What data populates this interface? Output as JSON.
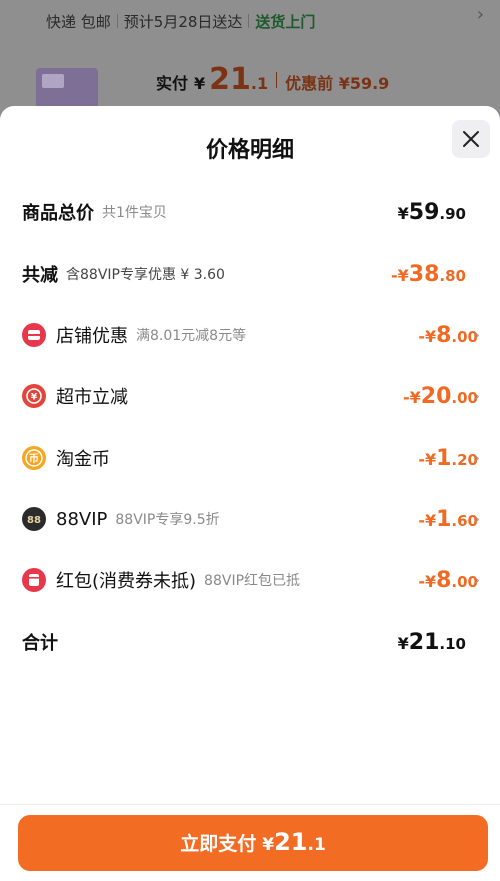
{
  "background": {
    "shipping": {
      "method": "快递 包邮",
      "eta": "预计5月28日送达",
      "delivery": "送货上门"
    },
    "payment": {
      "label": "实付",
      "currency": "¥",
      "int": "21",
      "dec": ".1",
      "before_discount": "优惠前 ¥59.9"
    }
  },
  "sheet": {
    "title": "价格明细",
    "rows": [
      {
        "label": "商品总价",
        "sub": "共1件宝贝",
        "sign": "",
        "currency": "¥",
        "int": "59",
        "dec": ".90",
        "color": "#111111"
      },
      {
        "label": "共减",
        "sub": "含88VIP专享优惠 ¥ 3.60",
        "sign": "-",
        "currency": "¥",
        "int": "38",
        "dec": ".80",
        "color": "#f06a23"
      },
      {
        "label": "店铺优惠",
        "sub": "满8.01元减8元等",
        "icon": "shop-coupon-icon",
        "sign": "-",
        "currency": "¥",
        "int": "8",
        "dec": ".00",
        "color": "#f06a23"
      },
      {
        "label": "超市立减",
        "sub": "",
        "icon": "supermarket-discount-icon",
        "sign": "-",
        "currency": "¥",
        "int": "20",
        "dec": ".00",
        "color": "#f06a23"
      },
      {
        "label": "淘金币",
        "sub": "",
        "icon": "gold-coin-icon",
        "sign": "-",
        "currency": "¥",
        "int": "1",
        "dec": ".20",
        "color": "#f06a23"
      },
      {
        "label": "88VIP",
        "sub": "88VIP专享9.5折",
        "icon": "vip88-icon",
        "sign": "-",
        "currency": "¥",
        "int": "1",
        "dec": ".60",
        "color": "#f06a23"
      },
      {
        "label": "红包(消费券未抵)",
        "sub": "88VIP红包已抵",
        "icon": "red-packet-icon",
        "sign": "-",
        "currency": "¥",
        "int": "8",
        "dec": ".00",
        "color": "#f06a23"
      },
      {
        "label": "合计",
        "sub": "",
        "sign": "",
        "currency": "¥",
        "int": "21",
        "dec": ".10",
        "color": "#111111"
      }
    ],
    "pay_button": {
      "label": "立即支付",
      "currency": "¥",
      "int": "21",
      "dec": ".1"
    }
  },
  "colors": {
    "accent": "#f26c24",
    "discount": "#f06a23"
  }
}
